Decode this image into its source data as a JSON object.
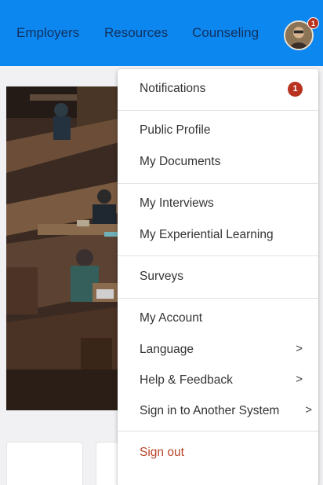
{
  "header": {
    "nav": [
      "Employers",
      "Resources",
      "Counseling"
    ],
    "avatar_badge": "1",
    "bar_color": "#0d87f0"
  },
  "user_menu": {
    "notifications": {
      "label": "Notifications",
      "badge": "1"
    },
    "items": [
      "Public Profile",
      "My Documents",
      "My Interviews",
      "My Experiential Learning",
      "Surveys",
      "My Account",
      "Language",
      "Help & Feedback",
      "Sign in to Another System"
    ],
    "submenu_chevron": ">",
    "sign_out": "Sign out",
    "sign_out_color": "#b9442a"
  }
}
